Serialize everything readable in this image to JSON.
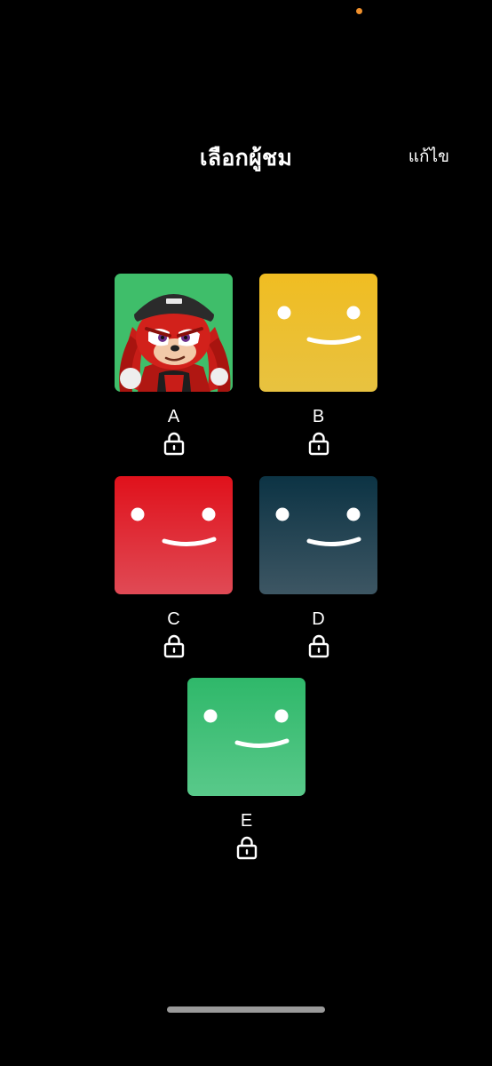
{
  "status": {
    "indicator_color": "#f0902c"
  },
  "header": {
    "title": "เลือกผู้ชม",
    "edit_label": "แก้ไข"
  },
  "profiles": [
    {
      "name": "A",
      "avatar": "knuckles-character-avatar",
      "bg_color": "#3fbe6a",
      "locked": true
    },
    {
      "name": "B",
      "avatar": "smiley-face-avatar",
      "bg_top": "#f0bd22",
      "bg_bottom": "#e8c240",
      "locked": true
    },
    {
      "name": "C",
      "avatar": "smiley-face-avatar",
      "bg_top": "#e0111b",
      "bg_bottom": "#e04a55",
      "locked": true
    },
    {
      "name": "D",
      "avatar": "smiley-face-avatar",
      "bg_top": "#0c3344",
      "bg_bottom": "#3d5663",
      "locked": true
    },
    {
      "name": "E",
      "avatar": "smiley-face-avatar",
      "bg_top": "#2fb86a",
      "bg_bottom": "#59c98a",
      "locked": true
    }
  ],
  "icons": {
    "lock": "lock-icon"
  }
}
